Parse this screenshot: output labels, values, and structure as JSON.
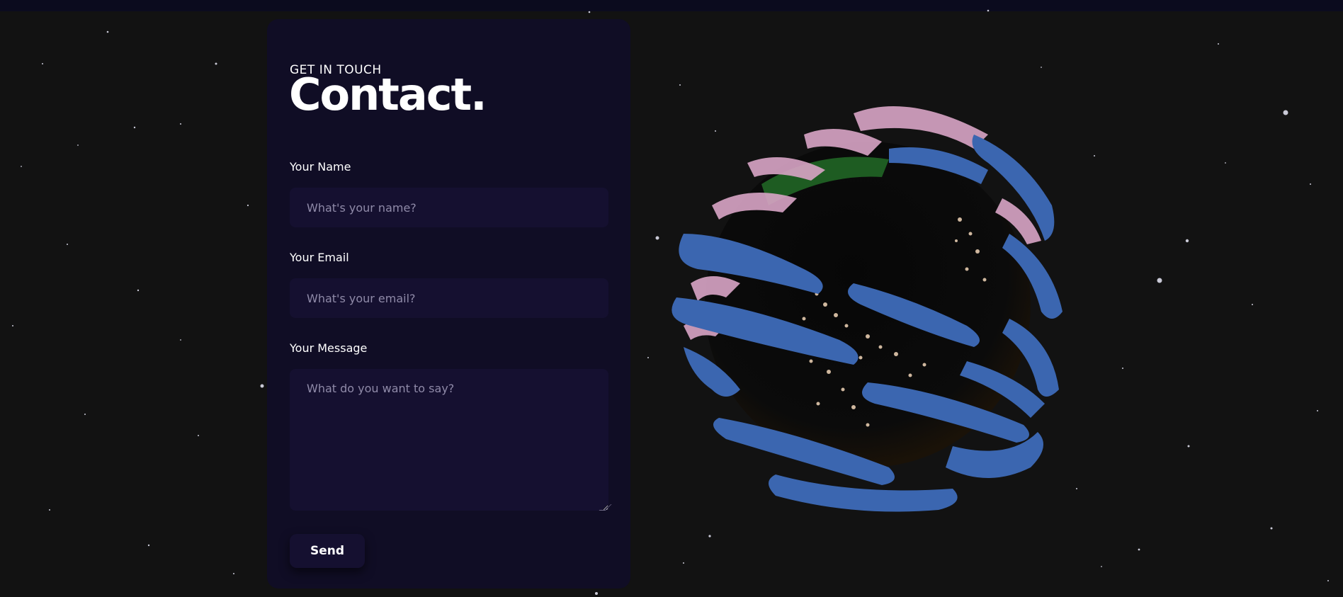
{
  "contact": {
    "eyebrow": "GET IN TOUCH",
    "title": "Contact.",
    "fields": [
      {
        "label": "Your Name",
        "placeholder": "What's your name?"
      },
      {
        "label": "Your Email",
        "placeholder": "What's your email?"
      },
      {
        "label": "Your Message",
        "placeholder": "What do you want to say?"
      }
    ],
    "send_label": "Send"
  },
  "colors": {
    "background": "#121212",
    "card": "#100d25",
    "input": "#151030",
    "text": "#ffffff",
    "placeholder": "#8f8aa8",
    "planet_bands": "#3b66b0",
    "planet_clouds": "#d9a5c6"
  },
  "scene": {
    "planet_icon": "earth-globe",
    "star_icon": "star-dot"
  }
}
